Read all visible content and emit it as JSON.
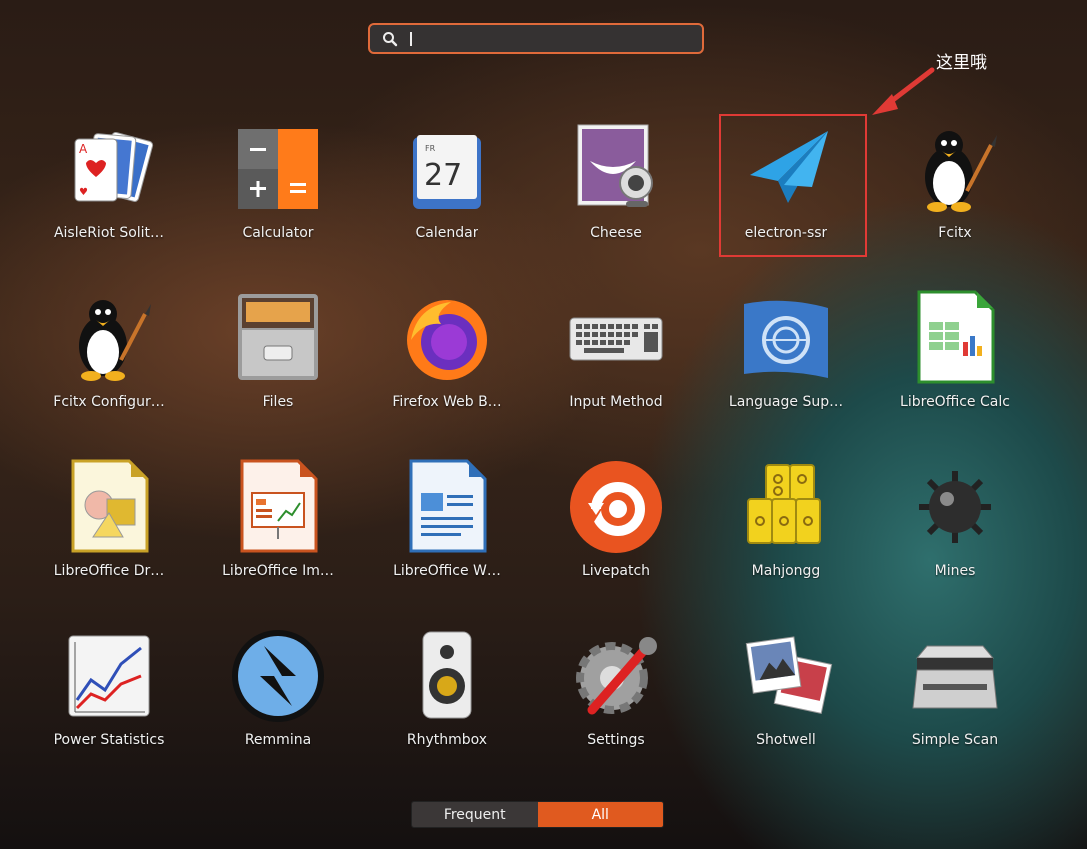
{
  "search": {
    "placeholder": "",
    "value": ""
  },
  "annotation": {
    "text": "这里哦"
  },
  "apps": [
    {
      "label": "AisleRiot Solit…",
      "icon": "playing-cards-icon"
    },
    {
      "label": "Calculator",
      "icon": "calculator-icon"
    },
    {
      "label": "Calendar",
      "icon": "calendar-icon",
      "day_abbr": "FR",
      "day": "27"
    },
    {
      "label": "Cheese",
      "icon": "webcam-icon"
    },
    {
      "label": "electron-ssr",
      "icon": "paper-plane-icon"
    },
    {
      "label": "Fcitx",
      "icon": "tux-penguin-icon"
    },
    {
      "label": "Fcitx Configur…",
      "icon": "tux-penguin-icon"
    },
    {
      "label": "Files",
      "icon": "file-cabinet-icon"
    },
    {
      "label": "Firefox Web B…",
      "icon": "firefox-icon"
    },
    {
      "label": "Input Method",
      "icon": "keyboard-icon"
    },
    {
      "label": "Language Sup…",
      "icon": "language-globe-icon"
    },
    {
      "label": "LibreOffice Calc",
      "icon": "spreadsheet-icon"
    },
    {
      "label": "LibreOffice Dr…",
      "icon": "draw-document-icon"
    },
    {
      "label": "LibreOffice Im…",
      "icon": "presentation-icon"
    },
    {
      "label": "LibreOffice W…",
      "icon": "writer-document-icon"
    },
    {
      "label": "Livepatch",
      "icon": "livepatch-icon"
    },
    {
      "label": "Mahjongg",
      "icon": "mahjong-tiles-icon"
    },
    {
      "label": "Mines",
      "icon": "mine-bomb-icon"
    },
    {
      "label": "Power Statistics",
      "icon": "power-graph-icon"
    },
    {
      "label": "Remmina",
      "icon": "remmina-icon"
    },
    {
      "label": "Rhythmbox",
      "icon": "speaker-icon"
    },
    {
      "label": "Settings",
      "icon": "settings-gear-icon"
    },
    {
      "label": "Shotwell",
      "icon": "photos-icon"
    },
    {
      "label": "Simple Scan",
      "icon": "scanner-icon"
    }
  ],
  "tabs": {
    "frequent": "Frequent",
    "all": "All"
  },
  "colors": {
    "accent": "#e05a1f",
    "highlight": "#e03a35"
  }
}
